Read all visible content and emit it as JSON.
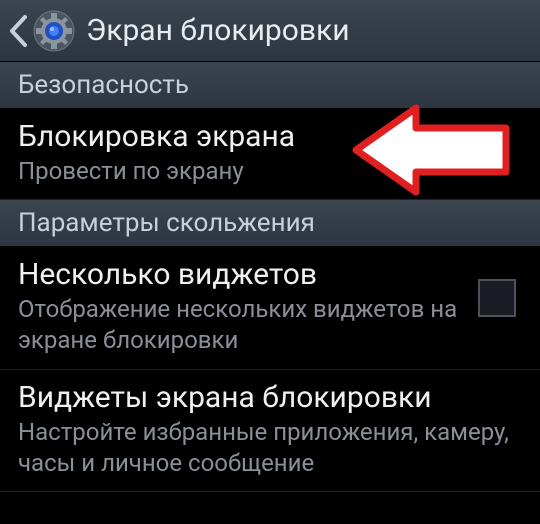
{
  "header": {
    "title": "Экран блокировки"
  },
  "sections": {
    "security": {
      "label": "Безопасность"
    },
    "slide": {
      "label": "Параметры скольжения"
    }
  },
  "items": {
    "screenLock": {
      "title": "Блокировка экрана",
      "subtitle": "Провести по экрану"
    },
    "multipleWidgets": {
      "title": "Несколько виджетов",
      "subtitle": "Отображение нескольких виджетов на экране блокировки"
    },
    "lockWidgets": {
      "title": "Виджеты экрана блокировки",
      "subtitle": "Настройте избранные приложения, камеру, часы и личное сообщение"
    }
  }
}
